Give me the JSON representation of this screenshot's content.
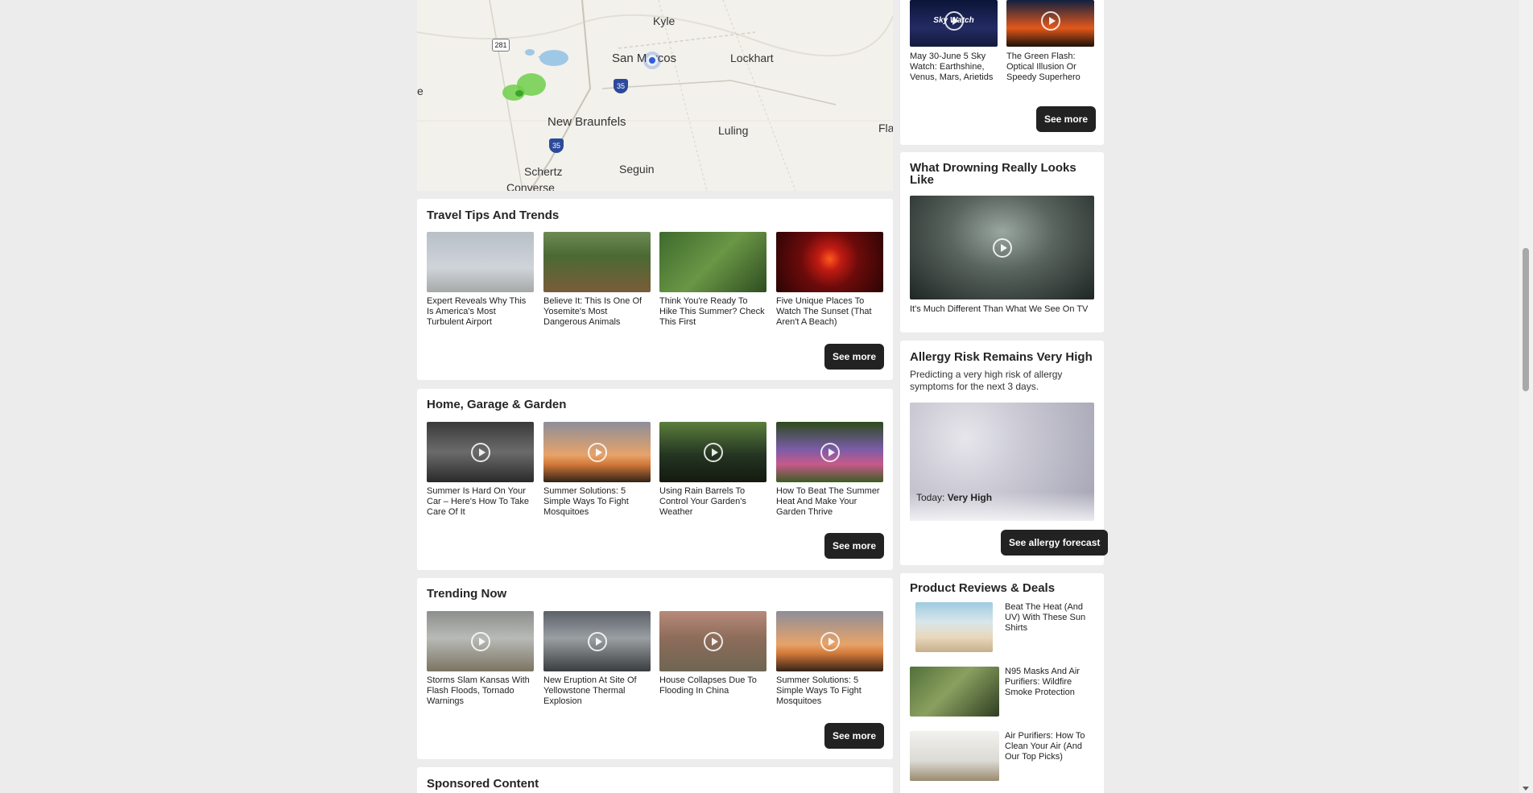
{
  "map": {
    "cities": [
      "Kyle",
      "San Marcos",
      "Lockhart",
      "New Braunfels",
      "Luling",
      "Schertz",
      "Seguin",
      "Converse",
      "Fla",
      "e"
    ],
    "highways": [
      "281",
      "35",
      "35"
    ]
  },
  "travel": {
    "title": "Travel Tips And Trends",
    "items": [
      {
        "caption": "Expert Reveals Why This Is America's Most Turbulent Airport"
      },
      {
        "caption": "Believe It: This Is One Of Yosemite's Most Dangerous Animals"
      },
      {
        "caption": "Think You're Ready To Hike This Summer? Check This First"
      },
      {
        "caption": "Five Unique Places To Watch The Sunset (That Aren't A Beach)"
      }
    ],
    "see_more": "See more"
  },
  "home": {
    "title": "Home, Garage & Garden",
    "items": [
      {
        "caption": "Summer Is Hard On Your Car – Here's How To Take Care Of It"
      },
      {
        "caption": "Summer Solutions: 5 Simple Ways To Fight Mosquitoes"
      },
      {
        "caption": "Using Rain Barrels To Control Your Garden's Weather"
      },
      {
        "caption": "How To Beat The Summer Heat And Make Your Garden Thrive"
      }
    ],
    "see_more": "See more"
  },
  "trending": {
    "title": "Trending Now",
    "items": [
      {
        "caption": "Storms Slam Kansas With Flash Floods, Tornado Warnings"
      },
      {
        "caption": "New Eruption At Site Of Yellowstone Thermal Explosion"
      },
      {
        "caption": "House Collapses Due To Flooding In China"
      },
      {
        "caption": "Summer Solutions: 5 Simple Ways To Fight Mosquitoes"
      }
    ],
    "see_more": "See more"
  },
  "sponsored": {
    "title": "Sponsored Content"
  },
  "sidebar": {
    "videos": {
      "items": [
        {
          "thumb_label": "Sky Watch",
          "caption": "May 30-June 5 Sky Watch: Earthshine, Venus, Mars, Arietids"
        },
        {
          "caption": "The Green Flash: Optical Illusion Or Speedy Superhero"
        }
      ],
      "see_more": "See more"
    },
    "drowning": {
      "title": "What Drowning Really Looks Like",
      "caption": "It's Much Different Than What We See On TV"
    },
    "allergy": {
      "title": "Allergy Risk Remains Very High",
      "description": "Predicting a very high risk of allergy symptoms for the next 3 days.",
      "today_label": "Today:",
      "today_value": "Very High",
      "button": "See allergy forecast"
    },
    "products": {
      "title": "Product Reviews & Deals",
      "items": [
        {
          "caption": "Beat The Heat (And UV) With These Sun Shirts"
        },
        {
          "caption": "N95 Masks And Air Purifiers: Wildfire Smoke Protection"
        },
        {
          "caption": "Air Purifiers: How To Clean Your Air (And Our Top Picks)"
        }
      ]
    }
  }
}
